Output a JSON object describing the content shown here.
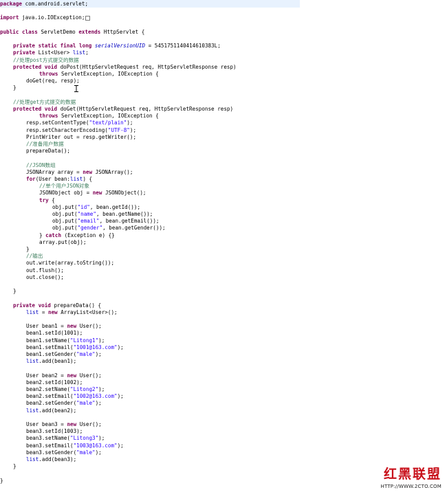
{
  "code_lines": [
    {
      "line": 1,
      "indent": 0,
      "hl": true,
      "tokens": [
        {
          "t": "package",
          "s": "kw"
        },
        {
          "t": " com.android.servlet;"
        }
      ]
    },
    {
      "line": 3,
      "indent": 0,
      "tokens": [
        {
          "t": "import",
          "s": "kw"
        },
        {
          "t": " java.io.IOException;"
        }
      ],
      "fold": true
    },
    {
      "line": 5,
      "indent": 0,
      "tokens": [
        {
          "t": "public",
          "s": "kw"
        },
        {
          "t": " "
        },
        {
          "t": "class",
          "s": "kw"
        },
        {
          "t": " ServletDemo "
        },
        {
          "t": "extends",
          "s": "kw"
        },
        {
          "t": " HttpServlet {"
        }
      ]
    },
    {
      "line": 7,
      "indent": 1,
      "tokens": [
        {
          "t": "private",
          "s": "kw"
        },
        {
          "t": " "
        },
        {
          "t": "static",
          "s": "kw"
        },
        {
          "t": " "
        },
        {
          "t": "final",
          "s": "kw"
        },
        {
          "t": " "
        },
        {
          "t": "long",
          "s": "kw"
        },
        {
          "t": " "
        },
        {
          "t": "serialVersionUID",
          "s": "field"
        },
        {
          "t": " = 5451751140414610383L;"
        }
      ]
    },
    {
      "line": 8,
      "indent": 1,
      "tokens": [
        {
          "t": "private",
          "s": "kw"
        },
        {
          "t": " List<User> "
        },
        {
          "t": "list",
          "s": "fld"
        },
        {
          "t": ";"
        }
      ]
    },
    {
      "line": 9,
      "indent": 1,
      "tokens": [
        {
          "t": "//处理post方式提交的数据",
          "s": "cmt"
        }
      ]
    },
    {
      "line": 10,
      "indent": 1,
      "tokens": [
        {
          "t": "protected",
          "s": "kw"
        },
        {
          "t": " "
        },
        {
          "t": "void",
          "s": "kw"
        },
        {
          "t": " doPost(HttpServletRequest req, HttpServletResponse resp)"
        }
      ]
    },
    {
      "line": 11,
      "indent": 3,
      "tokens": [
        {
          "t": "throws",
          "s": "kw"
        },
        {
          "t": " ServletException, IOException {"
        }
      ]
    },
    {
      "line": 12,
      "indent": 2,
      "tokens": [
        {
          "t": "doGet(req, resp);"
        }
      ]
    },
    {
      "line": 13,
      "indent": 1,
      "tokens": [
        {
          "t": "}"
        }
      ]
    },
    {
      "line": 15,
      "indent": 1,
      "tokens": [
        {
          "t": "//处理get方式提交的数据",
          "s": "cmt"
        }
      ]
    },
    {
      "line": 16,
      "indent": 1,
      "tokens": [
        {
          "t": "protected",
          "s": "kw"
        },
        {
          "t": " "
        },
        {
          "t": "void",
          "s": "kw"
        },
        {
          "t": " doGet(HttpServletRequest req, HttpServletResponse resp)"
        }
      ]
    },
    {
      "line": 17,
      "indent": 3,
      "tokens": [
        {
          "t": "throws",
          "s": "kw"
        },
        {
          "t": " ServletException, IOException {"
        }
      ]
    },
    {
      "line": 18,
      "indent": 2,
      "tokens": [
        {
          "t": "resp.setContentType("
        },
        {
          "t": "\"text/plain\"",
          "s": "str"
        },
        {
          "t": ");"
        }
      ]
    },
    {
      "line": 19,
      "indent": 2,
      "tokens": [
        {
          "t": "resp.setCharacterEncoding("
        },
        {
          "t": "\"UTF-8\"",
          "s": "str"
        },
        {
          "t": ");"
        }
      ]
    },
    {
      "line": 20,
      "indent": 2,
      "tokens": [
        {
          "t": "PrintWriter out = resp.getWriter();"
        }
      ]
    },
    {
      "line": 21,
      "indent": 2,
      "tokens": [
        {
          "t": "//准备用户数据",
          "s": "cmt"
        }
      ]
    },
    {
      "line": 22,
      "indent": 2,
      "tokens": [
        {
          "t": "prepareData();"
        }
      ]
    },
    {
      "line": 24,
      "indent": 2,
      "tokens": [
        {
          "t": "//JSON数组",
          "s": "cmt"
        }
      ]
    },
    {
      "line": 25,
      "indent": 2,
      "tokens": [
        {
          "t": "JSONArray array = "
        },
        {
          "t": "new",
          "s": "kw"
        },
        {
          "t": " JSONArray();"
        }
      ]
    },
    {
      "line": 26,
      "indent": 2,
      "tokens": [
        {
          "t": "for",
          "s": "kw"
        },
        {
          "t": "(User bean:"
        },
        {
          "t": "list",
          "s": "fld"
        },
        {
          "t": ") {"
        }
      ]
    },
    {
      "line": 27,
      "indent": 3,
      "tokens": [
        {
          "t": "//单个用户JSON对象",
          "s": "cmt"
        }
      ]
    },
    {
      "line": 28,
      "indent": 3,
      "tokens": [
        {
          "t": "JSONObject obj = "
        },
        {
          "t": "new",
          "s": "kw"
        },
        {
          "t": " JSONObject();"
        }
      ]
    },
    {
      "line": 29,
      "indent": 3,
      "tokens": [
        {
          "t": "try",
          "s": "kw"
        },
        {
          "t": " {"
        }
      ]
    },
    {
      "line": 30,
      "indent": 4,
      "tokens": [
        {
          "t": "obj.put("
        },
        {
          "t": "\"id\"",
          "s": "str"
        },
        {
          "t": ", bean.getId());"
        }
      ]
    },
    {
      "line": 31,
      "indent": 4,
      "tokens": [
        {
          "t": "obj.put("
        },
        {
          "t": "\"name\"",
          "s": "str"
        },
        {
          "t": ", bean.getName());"
        }
      ]
    },
    {
      "line": 32,
      "indent": 4,
      "tokens": [
        {
          "t": "obj.put("
        },
        {
          "t": "\"email\"",
          "s": "str"
        },
        {
          "t": ", bean.getEmail());"
        }
      ]
    },
    {
      "line": 33,
      "indent": 4,
      "tokens": [
        {
          "t": "obj.put("
        },
        {
          "t": "\"gender\"",
          "s": "str"
        },
        {
          "t": ", bean.getGender());"
        }
      ]
    },
    {
      "line": 34,
      "indent": 3,
      "tokens": [
        {
          "t": "} "
        },
        {
          "t": "catch",
          "s": "kw"
        },
        {
          "t": " (Exception e) {}"
        }
      ]
    },
    {
      "line": 35,
      "indent": 3,
      "tokens": [
        {
          "t": "array.put(obj);"
        }
      ]
    },
    {
      "line": 36,
      "indent": 2,
      "tokens": [
        {
          "t": "}"
        }
      ]
    },
    {
      "line": 37,
      "indent": 2,
      "tokens": [
        {
          "t": "//输出",
          "s": "cmt"
        }
      ]
    },
    {
      "line": 38,
      "indent": 2,
      "tokens": [
        {
          "t": "out.write(array.toString());"
        }
      ]
    },
    {
      "line": 39,
      "indent": 2,
      "tokens": [
        {
          "t": "out.flush();"
        }
      ]
    },
    {
      "line": 40,
      "indent": 2,
      "tokens": [
        {
          "t": "out.close();"
        }
      ]
    },
    {
      "line": 42,
      "indent": 1,
      "tokens": [
        {
          "t": "}"
        }
      ]
    },
    {
      "line": 44,
      "indent": 1,
      "tokens": [
        {
          "t": "private",
          "s": "kw"
        },
        {
          "t": " "
        },
        {
          "t": "void",
          "s": "kw"
        },
        {
          "t": " prepareData() {"
        }
      ]
    },
    {
      "line": 45,
      "indent": 2,
      "tokens": [
        {
          "t": "list",
          "s": "fld"
        },
        {
          "t": " = "
        },
        {
          "t": "new",
          "s": "kw"
        },
        {
          "t": " ArrayList<User>();"
        }
      ]
    },
    {
      "line": 47,
      "indent": 2,
      "tokens": [
        {
          "t": "User bean1 = "
        },
        {
          "t": "new",
          "s": "kw"
        },
        {
          "t": " User();"
        }
      ]
    },
    {
      "line": 48,
      "indent": 2,
      "tokens": [
        {
          "t": "bean1.setId(1001);"
        }
      ]
    },
    {
      "line": 49,
      "indent": 2,
      "tokens": [
        {
          "t": "bean1.setName("
        },
        {
          "t": "\"Litong1\"",
          "s": "str"
        },
        {
          "t": ");"
        }
      ]
    },
    {
      "line": 50,
      "indent": 2,
      "tokens": [
        {
          "t": "bean1.setEmail("
        },
        {
          "t": "\"1001@163.com\"",
          "s": "str"
        },
        {
          "t": ");"
        }
      ]
    },
    {
      "line": 51,
      "indent": 2,
      "tokens": [
        {
          "t": "bean1.setGender("
        },
        {
          "t": "\"male\"",
          "s": "str"
        },
        {
          "t": ");"
        }
      ]
    },
    {
      "line": 52,
      "indent": 2,
      "tokens": [
        {
          "t": "list",
          "s": "fld"
        },
        {
          "t": ".add(bean1);"
        }
      ]
    },
    {
      "line": 54,
      "indent": 2,
      "tokens": [
        {
          "t": "User bean2 = "
        },
        {
          "t": "new",
          "s": "kw"
        },
        {
          "t": " User();"
        }
      ]
    },
    {
      "line": 55,
      "indent": 2,
      "tokens": [
        {
          "t": "bean2.setId(1002);"
        }
      ]
    },
    {
      "line": 56,
      "indent": 2,
      "tokens": [
        {
          "t": "bean2.setName("
        },
        {
          "t": "\"Litong2\"",
          "s": "str"
        },
        {
          "t": ");"
        }
      ]
    },
    {
      "line": 57,
      "indent": 2,
      "tokens": [
        {
          "t": "bean2.setEmail("
        },
        {
          "t": "\"1002@163.com\"",
          "s": "str"
        },
        {
          "t": ");"
        }
      ]
    },
    {
      "line": 58,
      "indent": 2,
      "tokens": [
        {
          "t": "bean2.setGender("
        },
        {
          "t": "\"male\"",
          "s": "str"
        },
        {
          "t": ");"
        }
      ]
    },
    {
      "line": 59,
      "indent": 2,
      "tokens": [
        {
          "t": "list",
          "s": "fld"
        },
        {
          "t": ".add(bean2);"
        }
      ]
    },
    {
      "line": 61,
      "indent": 2,
      "tokens": [
        {
          "t": "User bean3 = "
        },
        {
          "t": "new",
          "s": "kw"
        },
        {
          "t": " User();"
        }
      ]
    },
    {
      "line": 62,
      "indent": 2,
      "tokens": [
        {
          "t": "bean3.setId(1003);"
        }
      ]
    },
    {
      "line": 63,
      "indent": 2,
      "tokens": [
        {
          "t": "bean3.setName("
        },
        {
          "t": "\"Litong3\"",
          "s": "str"
        },
        {
          "t": ");"
        }
      ]
    },
    {
      "line": 64,
      "indent": 2,
      "tokens": [
        {
          "t": "bean3.setEmail("
        },
        {
          "t": "\"1003@163.com\"",
          "s": "str"
        },
        {
          "t": ");"
        }
      ]
    },
    {
      "line": 65,
      "indent": 2,
      "tokens": [
        {
          "t": "bean3.setGender("
        },
        {
          "t": "\"male\"",
          "s": "str"
        },
        {
          "t": ");"
        }
      ]
    },
    {
      "line": 66,
      "indent": 2,
      "tokens": [
        {
          "t": "list",
          "s": "fld"
        },
        {
          "t": ".add(bean3);"
        }
      ]
    },
    {
      "line": 67,
      "indent": 1,
      "tokens": [
        {
          "t": "}"
        }
      ]
    },
    {
      "line": 69,
      "indent": 0,
      "tokens": [
        {
          "t": "}"
        }
      ]
    }
  ],
  "syntax_colors": {
    "keyword": "#7f0055",
    "string": "#2a00ff",
    "comment": "#3f7f5f",
    "field": "#0000c0",
    "current_line": "#e8f2fe"
  },
  "watermark": {
    "logo_text": "红黑联盟",
    "url": "HTTP://WWW.2CTO.COM"
  }
}
